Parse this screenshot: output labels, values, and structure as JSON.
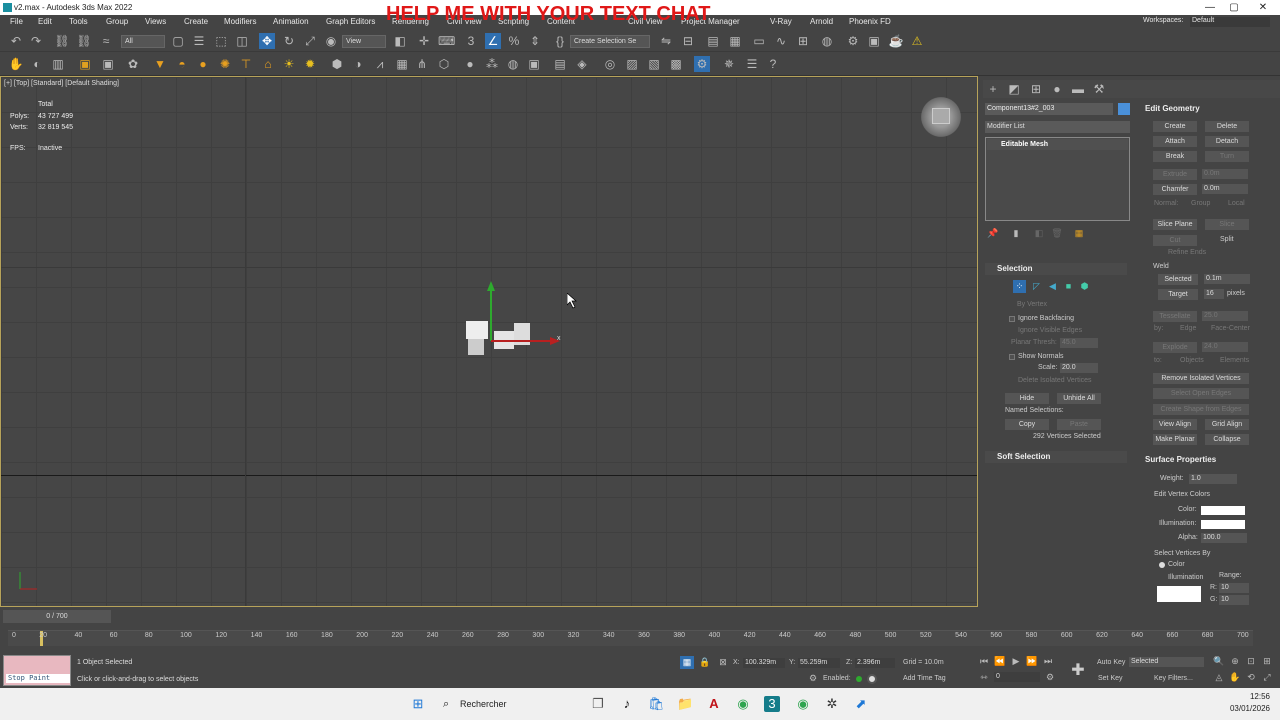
{
  "window": {
    "title": "v2.max - Autodesk 3ds Max 2022",
    "minimize": "—",
    "maximize": "▢",
    "close": "✕",
    "overlay_text": "HELP ME WITH YOUR TEXT CHAT"
  },
  "menu": {
    "items": [
      "File",
      "Edit",
      "Tools",
      "Group",
      "Views",
      "Create",
      "Modifiers",
      "Animation",
      "Graph Editors",
      "Rendering",
      "Civil View",
      "Scripting",
      "Content",
      "Civil View",
      "Project Manager",
      "V-Ray",
      "Arnold",
      "Phoenix FD"
    ],
    "workspaces_label": "Workspaces:",
    "workspaces_value": "Default"
  },
  "toolbar": {
    "filter": "All",
    "ref_coord": "View",
    "selection_set": "Create Selection Se"
  },
  "viewport": {
    "label": "[+] [Top] [Standard] [Default Shading]",
    "stats_header": "Total",
    "polys_label": "Polys:",
    "polys_value": "43 727 499",
    "verts_label": "Verts:",
    "verts_value": "32 819 545",
    "fps_label": "FPS:",
    "fps_value": "Inactive",
    "axis_x": "x"
  },
  "command_panel": {
    "object_name": "Component13#2_003",
    "object_color": "#4a90d9",
    "modifier_list": "Modifier List",
    "stack_item": "Editable Mesh",
    "selection_rollout": "Selection",
    "by_vertex": "By Vertex",
    "ignore_backfacing": "Ignore Backfacing",
    "ignore_visible_edges": "Ignore Visible Edges",
    "planar_thresh_label": "Planar Thresh:",
    "planar_thresh_value": "45.0",
    "show_normals": "Show Normals",
    "scale_label": "Scale:",
    "scale_value": "20.0",
    "delete_isolated": "Delete Isolated Vertices",
    "hide": "Hide",
    "unhide_all": "Unhide All",
    "named_selections": "Named Selections:",
    "copy": "Copy",
    "paste": "Paste",
    "vertices_selected": "292 Vertices Selected",
    "soft_selection": "Soft Selection"
  },
  "edit_geometry": {
    "title": "Edit Geometry",
    "create": "Create",
    "delete": "Delete",
    "attach": "Attach",
    "detach": "Detach",
    "break": "Break",
    "turn": "Turn",
    "extrude": "Extrude",
    "extrude_value": "0.0m",
    "chamfer": "Chamfer",
    "chamfer_value": "0.0m",
    "normal_label": "Normal:",
    "group": "Group",
    "local": "Local",
    "slice_plane": "Slice Plane",
    "slice": "Slice",
    "cut": "Cut",
    "split": "Split",
    "refine_ends": "Refine Ends",
    "weld": "Weld",
    "selected": "Selected",
    "selected_value": "0.1m",
    "target": "Target",
    "target_value": "16",
    "pixels": "pixels",
    "tessellate": "Tessellate",
    "tessellate_value": "25.0",
    "by_label": "by:",
    "edge": "Edge",
    "face_center": "Face-Center",
    "explode": "Explode",
    "explode_value": "24.0",
    "to_label": "to:",
    "objects": "Objects",
    "elements": "Elements",
    "remove_isolated": "Remove Isolated Vertices",
    "select_open_edges": "Select Open Edges",
    "create_shape": "Create Shape from Edges",
    "view_align": "View Align",
    "grid_align": "Grid Align",
    "make_planar": "Make Planar",
    "collapse": "Collapse"
  },
  "surface_properties": {
    "title": "Surface Properties",
    "weight_label": "Weight:",
    "weight_value": "1.0",
    "edit_vertex_colors": "Edit Vertex Colors",
    "color_label": "Color:",
    "illumination_label": "Illumination:",
    "alpha_label": "Alpha:",
    "alpha_value": "100.0",
    "select_vertices_by": "Select Vertices By",
    "color_radio": "Color",
    "illumination_radio": "Illumination",
    "range_label": "Range:",
    "r_label": "R:",
    "r_value": "10",
    "g_label": "G:",
    "g_value": "10"
  },
  "timeline": {
    "slider": "0 / 700",
    "ticks": [
      "0",
      "20",
      "40",
      "60",
      "80",
      "100",
      "120",
      "140",
      "160",
      "180",
      "200",
      "220",
      "240",
      "260",
      "280",
      "300",
      "320",
      "340",
      "360",
      "380",
      "400",
      "420",
      "440",
      "460",
      "480",
      "500",
      "520",
      "540",
      "560",
      "580",
      "600",
      "620",
      "640",
      "660",
      "680",
      "700"
    ]
  },
  "status": {
    "stop_paint": "Stop Paint",
    "selected_count": "1 Object Selected",
    "prompt": "Click or click-and-drag to select objects",
    "x_label": "X:",
    "x_value": "100.329m",
    "y_label": "Y:",
    "y_value": "55.259m",
    "z_label": "Z:",
    "z_value": "2.396m",
    "grid": "Grid = 10.0m",
    "enabled": "Enabled:",
    "add_time_tag": "Add Time Tag",
    "frame": "0",
    "auto_key": "Auto Key",
    "set_key": "Set Key",
    "selected_dropdown": "Selected",
    "key_filters": "Key Filters..."
  },
  "taskbar": {
    "search": "Rechercher",
    "time": "12:56",
    "date": "03/01/2026"
  }
}
